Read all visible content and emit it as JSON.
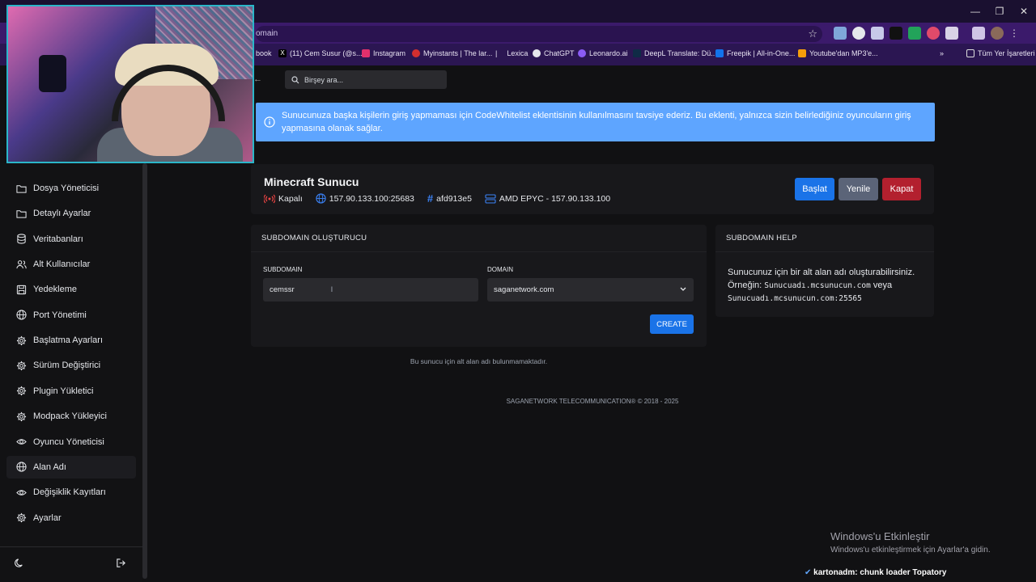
{
  "browser": {
    "url_fragment": "omain",
    "bookmarks": [
      {
        "label": "book",
        "color": "#2b1652"
      },
      {
        "label": "(11) Cem Susur (@s...",
        "color": "#000000"
      },
      {
        "label": "Instagram",
        "color": "#e1306c"
      },
      {
        "label": "Myinstants | The lar...",
        "color": "#d32f2f"
      },
      {
        "label": "Lexica",
        "color": "#ffffff"
      },
      {
        "label": "ChatGPT",
        "color": "#e5e7eb"
      },
      {
        "label": "Leonardo.ai",
        "color": "#8b5cf6"
      },
      {
        "label": "DeepL Translate: Dü...",
        "color": "#0f2b46"
      },
      {
        "label": "Freepik | All-in-One...",
        "color": "#1273eb"
      },
      {
        "label": "Youtube'dan MP3'e...",
        "color": "#f59e0b"
      }
    ],
    "bookmarks_all": "Tüm Yer İşaretleri"
  },
  "search": {
    "placeholder": "Birşey ara..."
  },
  "alert": {
    "text": "Sunucunuza başka kişilerin giriş yapmaması için CodeWhitelist eklentisinin kullanılmasını tavsiye ederiz. Bu eklenti, yalnızca sizin belirlediğiniz oyuncuların giriş yapmasına olanak sağlar."
  },
  "sidebar": {
    "items": [
      {
        "label": "Dosya Yöneticisi",
        "icon": "folder-icon"
      },
      {
        "label": "Detaylı Ayarlar",
        "icon": "folder-icon"
      },
      {
        "label": "Veritabanları",
        "icon": "database-icon"
      },
      {
        "label": "Alt Kullanıcılar",
        "icon": "users-icon"
      },
      {
        "label": "Yedekleme",
        "icon": "save-icon"
      },
      {
        "label": "Port Yönetimi",
        "icon": "globe-icon"
      },
      {
        "label": "Başlatma Ayarları",
        "icon": "gear-icon"
      },
      {
        "label": "Sürüm Değiştirici",
        "icon": "gear-icon"
      },
      {
        "label": "Plugin Yükletici",
        "icon": "gear-icon"
      },
      {
        "label": "Modpack Yükleyici",
        "icon": "gear-icon"
      },
      {
        "label": "Oyuncu Yöneticisi",
        "icon": "eye-icon"
      },
      {
        "label": "Alan Adı",
        "icon": "globe-icon",
        "active": true
      },
      {
        "label": "Değişiklik Kayıtları",
        "icon": "eye-icon"
      },
      {
        "label": "Ayarlar",
        "icon": "gear-icon"
      }
    ]
  },
  "server": {
    "title": "Minecraft Sunucu",
    "status": "Kapalı",
    "address": "157.90.133.100:25683",
    "id": "afd913e5",
    "node": "AMD EPYC - 157.90.133.100",
    "buttons": {
      "start": "Başlat",
      "restart": "Yenile",
      "stop": "Kapat"
    }
  },
  "creator": {
    "title": "SUBDOMAIN OLUŞTURUCU",
    "subdomain_label": "SUBDOMAIN",
    "subdomain_value": "cemssr",
    "domain_label": "DOMAIN",
    "domain_value": "saganetwork.com",
    "create_label": "CREATE"
  },
  "help": {
    "title": "SUBDOMAIN HELP",
    "line1": "Sunucunuz için bir alt alan adı oluşturabilirsiniz.",
    "example_prefix": "Örneğin:",
    "example1": "Sunucuadı.mcsunucun.com",
    "example_mid": "veya",
    "example2": "Sunucuadı.mcsunucun.com:25565"
  },
  "empty_text": "Bu sunucu için alt alan adı bulunmamaktadır.",
  "footer": "SAGANETWORK TELECOMMUNICATION® © 2018 - 2025",
  "windows": {
    "activate_title": "Windows'u Etkinleştir",
    "activate_sub": "Windows'u etkinleştirmek için Ayarlar'a gidin."
  },
  "chat": {
    "user": "kartonadm:",
    "message": "chunk loader Topatory"
  },
  "colors": {
    "accent": "#1a73e8",
    "alert": "#5ea5ff",
    "danger": "#b3202e",
    "status_off": "#ef4444"
  }
}
